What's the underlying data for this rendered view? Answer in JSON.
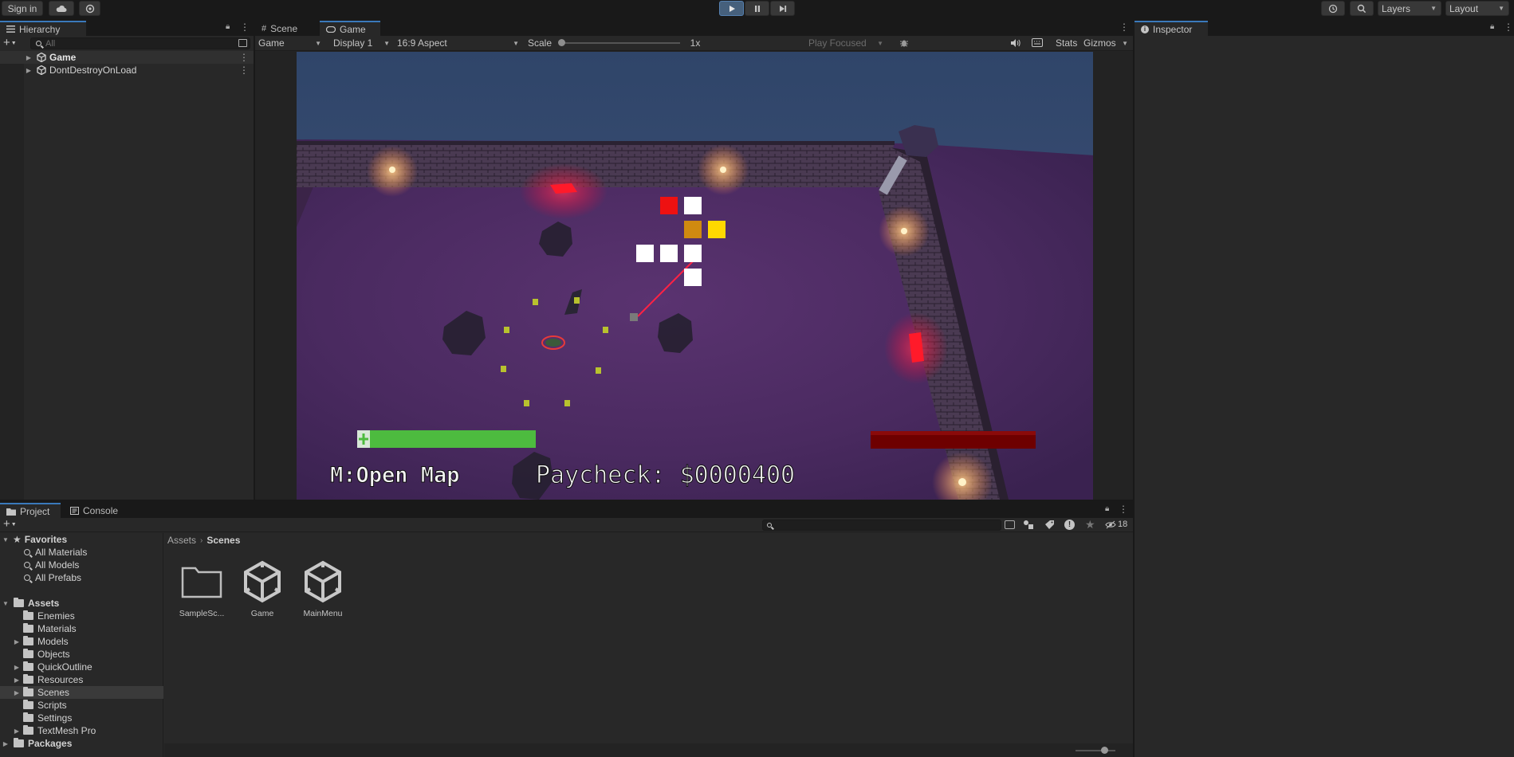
{
  "toolbar": {
    "sign_in": "Sign in",
    "layers": "Layers",
    "layout": "Layout"
  },
  "hierarchy": {
    "tab": "Hierarchy",
    "search_placeholder": "All",
    "items": [
      {
        "label": "Game"
      },
      {
        "label": "DontDestroyOnLoad"
      }
    ]
  },
  "game_view": {
    "tabs": [
      "Scene",
      "Game"
    ],
    "mode": "Game",
    "display": "Display 1",
    "aspect": "16:9 Aspect",
    "scale_label": "Scale",
    "scale_value": "1x",
    "play_focused": "Play Focused",
    "stats": "Stats",
    "gizmos": "Gizmos",
    "hud": {
      "map_hint": "M:Open Map",
      "paycheck": "Paycheck: $0000400",
      "health_fraction": 1.0,
      "boss_health_fraction": 1.0
    },
    "colors": {
      "sky": "#3a4f78",
      "floor": "#4a2a5a",
      "health": "#4dbb3f",
      "boss_bar": "#6e0000",
      "laser": "#ff2244"
    }
  },
  "inspector": {
    "tab": "Inspector"
  },
  "project": {
    "tabs": [
      "Project",
      "Console"
    ],
    "hidden_count": "18",
    "favorites": {
      "label": "Favorites",
      "items": [
        "All Materials",
        "All Models",
        "All Prefabs"
      ]
    },
    "assets": {
      "label": "Assets",
      "items": [
        {
          "label": "Enemies",
          "expandable": false
        },
        {
          "label": "Materials",
          "expandable": false
        },
        {
          "label": "Models",
          "expandable": true
        },
        {
          "label": "Objects",
          "expandable": false
        },
        {
          "label": "QuickOutline",
          "expandable": true
        },
        {
          "label": "Resources",
          "expandable": true
        },
        {
          "label": "Scenes",
          "expandable": true,
          "selected": true
        },
        {
          "label": "Scripts",
          "expandable": false
        },
        {
          "label": "Settings",
          "expandable": false
        },
        {
          "label": "TextMesh Pro",
          "expandable": true
        }
      ]
    },
    "packages": "Packages",
    "breadcrumb": [
      "Assets",
      "Scenes"
    ],
    "files": [
      {
        "label": "SampleSc...",
        "icon": "folder-icon"
      },
      {
        "label": "Game",
        "icon": "unity-scene-icon"
      },
      {
        "label": "MainMenu",
        "icon": "unity-scene-icon"
      }
    ]
  }
}
